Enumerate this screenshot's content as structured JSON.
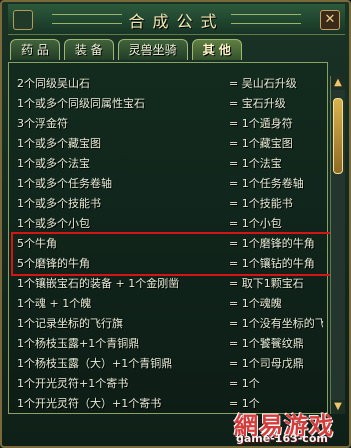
{
  "window": {
    "title": "合成公式",
    "close_label": "✕"
  },
  "tabs": [
    {
      "label": "药 品"
    },
    {
      "label": "装 备"
    },
    {
      "label": "灵兽坐骑"
    },
    {
      "label": "其 他"
    }
  ],
  "formulas": [
    {
      "input": "2个同级吴山石",
      "output": "= 吴山石升级"
    },
    {
      "input": "1个或多个同级同属性宝石",
      "output": "= 宝石升级"
    },
    {
      "input": "3个浮金符",
      "output": "= 1个遁身符"
    },
    {
      "input": "1个或多个藏宝图",
      "output": "= 1个藏宝图"
    },
    {
      "input": "1个或多个法宝",
      "output": "= 1个法宝"
    },
    {
      "input": "1个或多个任务卷轴",
      "output": "= 1个任务卷轴"
    },
    {
      "input": "1个或多个技能书",
      "output": "= 1个技能书"
    },
    {
      "input": "1个或多个小包",
      "output": "= 1个小包"
    },
    {
      "input": "5个牛角",
      "output": "= 1个磨锋的牛角"
    },
    {
      "input": "5个磨锋的牛角",
      "output": "= 1个镶钻的牛角"
    },
    {
      "input": "1个镶嵌宝石的装备 + 1个金刚凿",
      "output": "= 取下1颗宝石"
    },
    {
      "input": "1个魂 + 1个魄",
      "output": "= 1个魂魄"
    },
    {
      "input": "1个记录坐标的飞行旗",
      "output": "= 1个没有坐标的飞"
    },
    {
      "input": "1个杨枝玉露+1个青铜鼎",
      "output": "= 1个饕餮纹鼎"
    },
    {
      "input": "1个杨枝玉露（大）+1个青铜鼎",
      "output": "= 1个司母戊鼎"
    },
    {
      "input": "1个开光灵符+1个寄书",
      "output": "= 1个"
    },
    {
      "input": "1个开光灵符（大）+1个寄书",
      "output": "= 1个"
    }
  ],
  "scrollbar": {
    "up_icon": "▲",
    "down_icon": "▼"
  },
  "watermark": {
    "brand": "網易游戏",
    "url": "game-163-com"
  }
}
